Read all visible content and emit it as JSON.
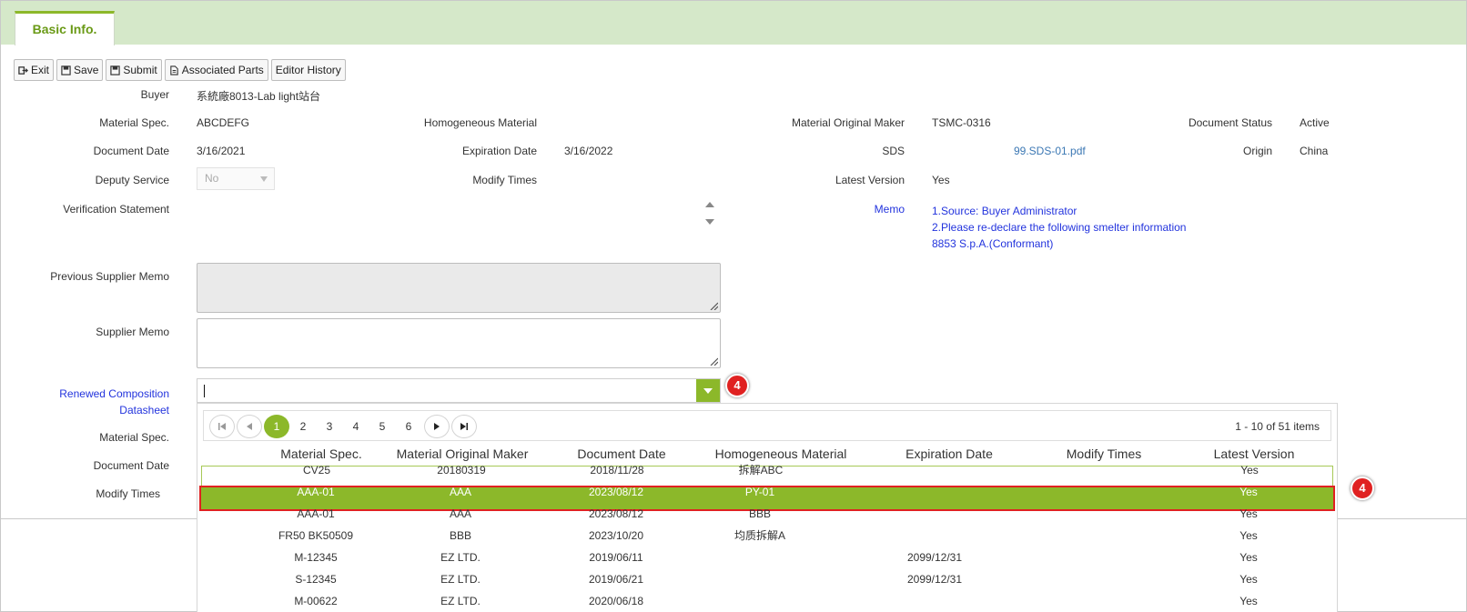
{
  "tab": {
    "label": "Basic Info."
  },
  "toolbar": {
    "exit": "Exit",
    "save": "Save",
    "submit": "Submit",
    "associated_parts": "Associated Parts",
    "editor_history": "Editor History"
  },
  "form": {
    "buyer_label": "Buyer",
    "buyer_value": "系統廠8013-Lab light站台",
    "material_spec_label": "Material Spec.",
    "material_spec_value": "ABCDEFG",
    "homogeneous_label": "Homogeneous Material",
    "original_maker_label": "Material Original Maker",
    "original_maker_value": "TSMC-0316",
    "doc_status_label": "Document Status",
    "doc_status_value": "Active",
    "doc_date_label": "Document Date",
    "doc_date_value": "3/16/2021",
    "exp_date_label": "Expiration Date",
    "exp_date_value": "3/16/2022",
    "sds_label": "SDS",
    "sds_value": "99.SDS-01.pdf",
    "origin_label": "Origin",
    "origin_value": "China",
    "deputy_label": "Deputy Service",
    "deputy_value": "No",
    "modify_label": "Modify Times",
    "latest_label": "Latest Version",
    "latest_value": "Yes",
    "verification_label": "Verification Statement",
    "memo_label": "Memo",
    "memo_lines": [
      "1.Source: Buyer Administrator",
      "2.Please re-declare the following smelter information",
      "8853 S.p.A.(Conformant)"
    ],
    "prev_supplier_memo_label": "Previous Supplier Memo",
    "supplier_memo_label": "Supplier Memo",
    "renewed_label_1": "Renewed Composition",
    "renewed_label_2": "Datasheet",
    "lower_material_spec_label": "Material Spec.",
    "lower_doc_date_label": "Document Date",
    "lower_modify_label": "Modify Times"
  },
  "badges": {
    "combo_badge": "4",
    "row_badge": "4"
  },
  "pager": {
    "pages": [
      "1",
      "2",
      "3",
      "4",
      "5",
      "6"
    ],
    "active_page": "1",
    "info": "1 - 10 of 51 items"
  },
  "table": {
    "columns": [
      "Material Spec.",
      "Material Original Maker",
      "Document Date",
      "Homogeneous Material",
      "Expiration Date",
      "Modify Times",
      "Latest Version"
    ],
    "rows": [
      [
        "CV25",
        "20180319",
        "2018/11/28",
        "拆解ABC",
        "",
        "",
        "Yes"
      ],
      [
        "AAA-01",
        "AAA",
        "2023/08/12",
        "PY-01",
        "",
        "",
        "Yes"
      ],
      [
        "AAA-01",
        "AAA",
        "2023/08/12",
        "BBB",
        "",
        "",
        "Yes"
      ],
      [
        "FR50 BK50509",
        "BBB",
        "2023/10/20",
        "均质拆解A",
        "",
        "",
        "Yes"
      ],
      [
        "M-12345",
        "EZ LTD.",
        "2019/06/11",
        "",
        "2099/12/31",
        "",
        "Yes"
      ],
      [
        "S-12345",
        "EZ LTD.",
        "2019/06/21",
        "",
        "2099/12/31",
        "",
        "Yes"
      ],
      [
        "M-00622",
        "EZ LTD.",
        "2020/06/18",
        "",
        "",
        "",
        "Yes"
      ]
    ]
  },
  "colors": {
    "accent": "#8cb82a",
    "tabbar": "#d5e8c9",
    "badge": "#e02121",
    "link": "#3c78b4",
    "memo": "#2233dd"
  }
}
